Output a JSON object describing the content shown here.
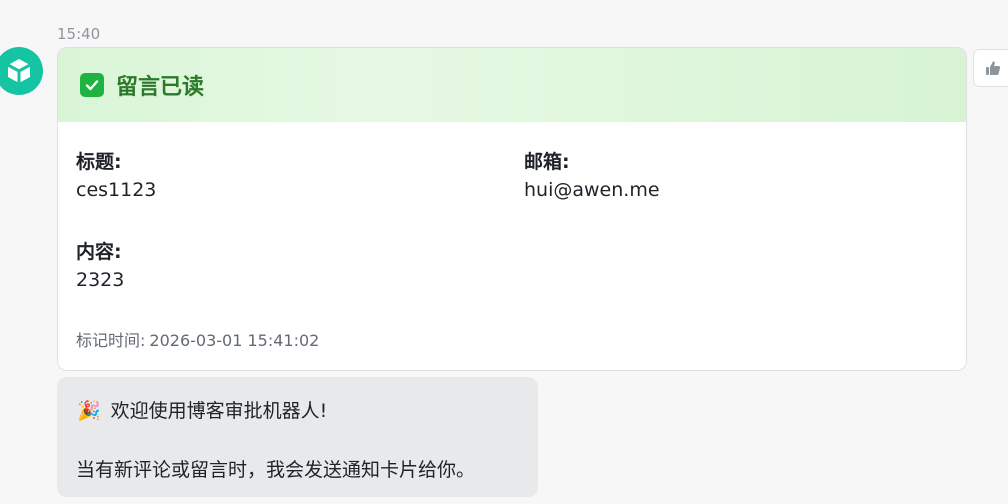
{
  "message": {
    "time": "15:40",
    "avatar_icon": "cube-icon"
  },
  "card": {
    "title": "留言已读",
    "header_color": "#d9f5d6",
    "accent_color": "#1fb342",
    "fields": {
      "title_label": "标题:",
      "title_value": "ces1123",
      "email_label": "邮箱:",
      "email_value": "hui@awen.me",
      "content_label": "内容:",
      "content_value": "2323"
    },
    "marked_time_label": "标记时间:",
    "marked_time_value": "2026-03-01 15:41:02"
  },
  "like_button": {
    "icon": "thumbs-up-icon"
  },
  "welcome": {
    "emoji": "🎉",
    "line1": "欢迎使用博客审批机器人!",
    "line2": "当有新评论或留言时，我会发送通知卡片给你。"
  }
}
